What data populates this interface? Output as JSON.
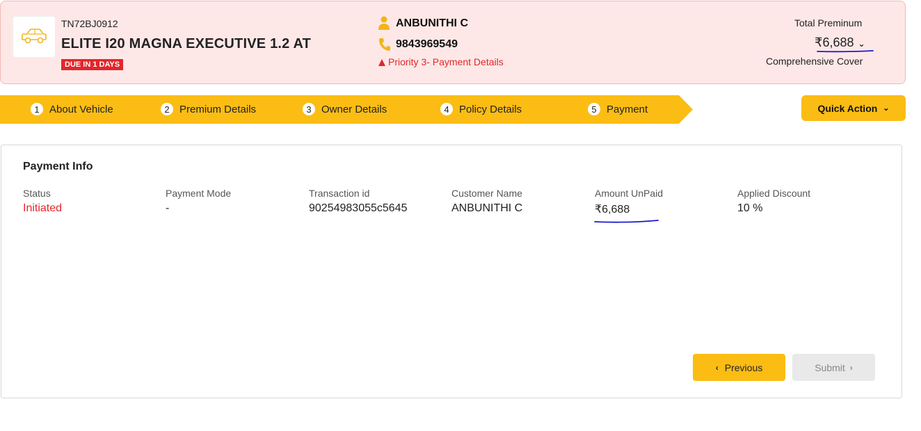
{
  "header": {
    "registration": "TN72BJ0912",
    "model": "ELITE I20 MAGNA EXECUTIVE 1.2 AT",
    "due_badge": "DUE IN 1 DAYS",
    "owner_name": "ANBUNITHI C",
    "phone": "9843969549",
    "priority": "Priority 3- Payment Details",
    "total_premium_label": "Total Preminum",
    "total_premium_value": "₹6,688",
    "cover_type": "Comprehensive Cover",
    "icons": [
      "car-icon",
      "person-icon",
      "phone-icon",
      "warning-icon",
      "chevron-down-icon"
    ]
  },
  "steps": [
    {
      "num": "1",
      "label": "About Vehicle"
    },
    {
      "num": "2",
      "label": "Premium Details"
    },
    {
      "num": "3",
      "label": "Owner Details"
    },
    {
      "num": "4",
      "label": "Policy Details"
    },
    {
      "num": "5",
      "label": "Payment"
    }
  ],
  "quick_action": {
    "label": "Quick Action"
  },
  "payment_info": {
    "title": "Payment Info",
    "fields": [
      {
        "label": "Status",
        "value": "Initiated"
      },
      {
        "label": "Payment Mode",
        "value": "-"
      },
      {
        "label": "Transaction id",
        "value": "90254983055c5645"
      },
      {
        "label": "Customer Name",
        "value": "ANBUNITHI C"
      },
      {
        "label": "Amount UnPaid",
        "value": "₹6,688"
      },
      {
        "label": "Applied Discount",
        "value": "10 %"
      }
    ]
  },
  "buttons": {
    "previous": "Previous",
    "submit": "Submit"
  },
  "colors": {
    "accent": "#fbbd14",
    "danger": "#e3262b",
    "header_bg": "#fde8e7",
    "annotation": "#1b1bd0"
  }
}
